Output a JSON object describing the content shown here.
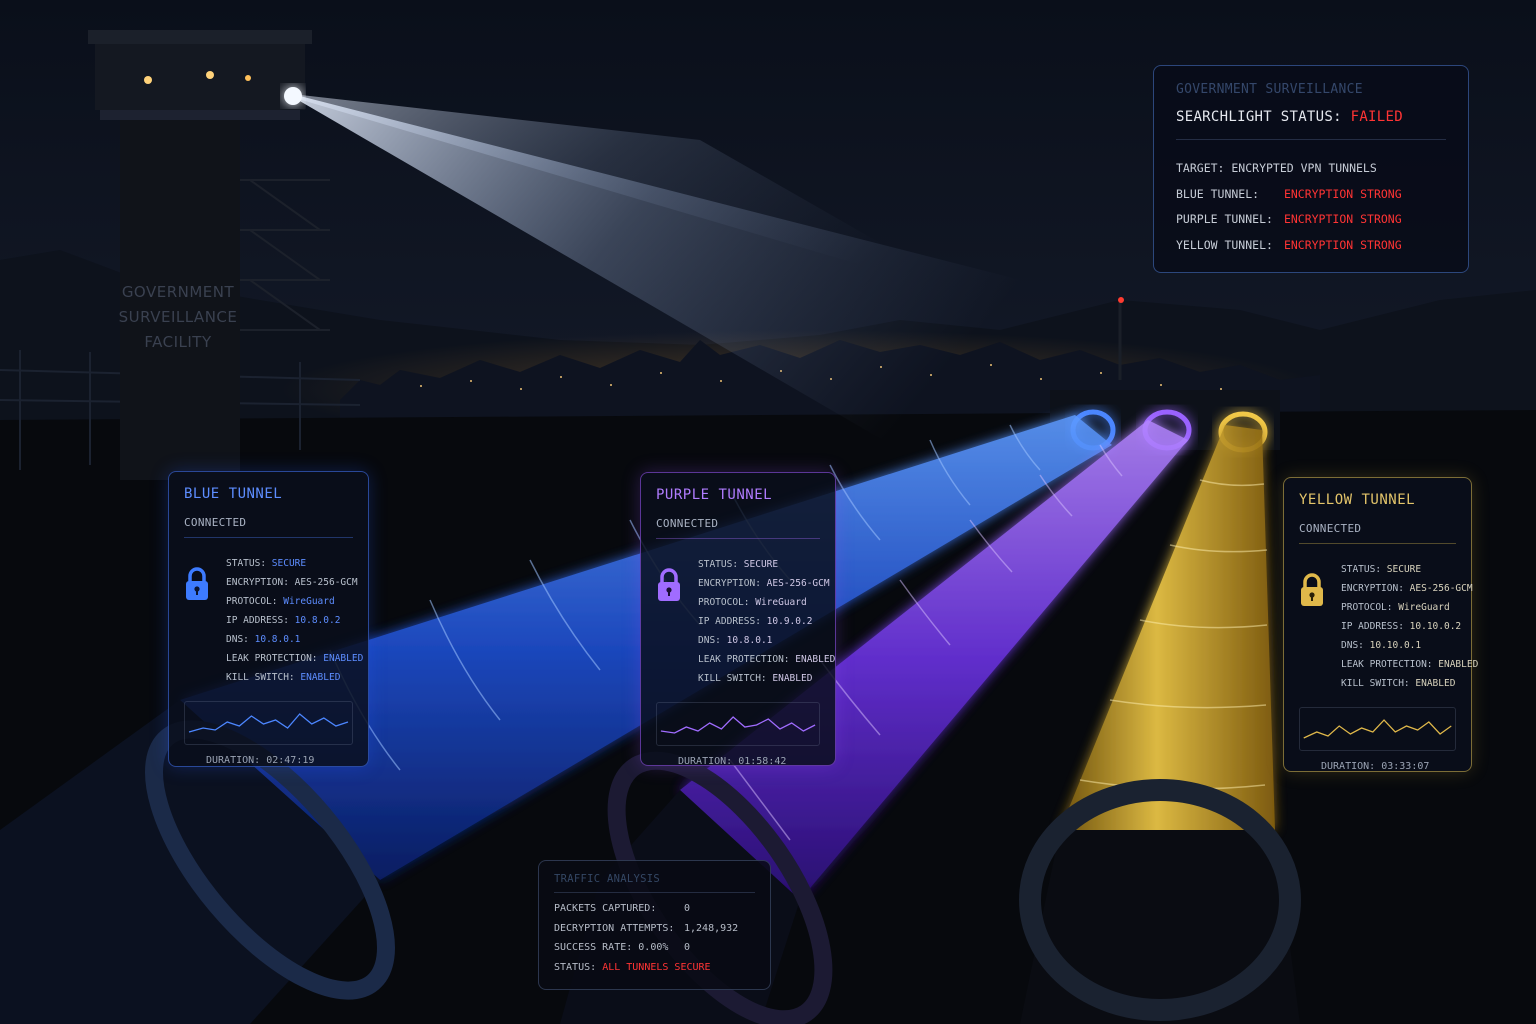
{
  "facility": {
    "sign_lines": [
      "GOVERNMENT",
      "SURVEILLANCE",
      "FACILITY"
    ]
  },
  "surveillance": {
    "header": "GOVERNMENT SURVEILLANCE",
    "status_label": "SEARCHLIGHT STATUS:",
    "status_value": "FAILED",
    "target": "TARGET: ENCRYPTED VPN TUNNELS",
    "rows": [
      {
        "label": "BLUE TUNNEL:",
        "value": "ENCRYPTION STRONG"
      },
      {
        "label": "PURPLE TUNNEL:",
        "value": "ENCRYPTION STRONG"
      },
      {
        "label": "YELLOW TUNNEL:",
        "value": "ENCRYPTION STRONG"
      }
    ]
  },
  "tunnels": {
    "blue": {
      "title": "BLUE TUNNEL",
      "connection": "CONNECTED",
      "rows": [
        {
          "label": "STATUS:",
          "value": "SECURE"
        },
        {
          "label": "ENCRYPTION:",
          "value": "AES-256-GCM"
        },
        {
          "label": "PROTOCOL:",
          "value": "WireGuard"
        },
        {
          "label": "IP ADDRESS:",
          "value": "10.8.0.2"
        },
        {
          "label": "DNS:",
          "value": "10.8.0.1"
        },
        {
          "label": "LEAK PROTECTION:",
          "value": "ENABLED"
        },
        {
          "label": "KILL SWITCH:",
          "value": "ENABLED"
        }
      ],
      "duration_label": "DURATION:",
      "duration": "02:47:19",
      "accent": "#5d8dff"
    },
    "purple": {
      "title": "PURPLE TUNNEL",
      "connection": "CONNECTED",
      "rows": [
        {
          "label": "STATUS:",
          "value": "SECURE"
        },
        {
          "label": "ENCRYPTION:",
          "value": "AES-256-GCM"
        },
        {
          "label": "PROTOCOL:",
          "value": "WireGuard"
        },
        {
          "label": "IP ADDRESS:",
          "value": "10.9.0.2"
        },
        {
          "label": "DNS:",
          "value": "10.8.0.1"
        },
        {
          "label": "LEAK PROTECTION:",
          "value": "ENABLED"
        },
        {
          "label": "KILL SWITCH:",
          "value": "ENABLED"
        }
      ],
      "duration_label": "DURATION:",
      "duration": "01:58:42",
      "accent": "#b07cff"
    },
    "yellow": {
      "title": "YELLOW TUNNEL",
      "connection": "CONNECTED",
      "rows": [
        {
          "label": "STATUS:",
          "value": "SECURE"
        },
        {
          "label": "ENCRYPTION:",
          "value": "AES-256-GCM"
        },
        {
          "label": "PROTOCOL:",
          "value": "WireGuard"
        },
        {
          "label": "IP ADDRESS:",
          "value": "10.10.0.2"
        },
        {
          "label": "DNS:",
          "value": "10.10.0.1"
        },
        {
          "label": "LEAK PROTECTION:",
          "value": "ENABLED"
        },
        {
          "label": "KILL SWITCH:",
          "value": "ENABLED"
        }
      ],
      "duration_label": "DURATION:",
      "duration": "03:33:07",
      "accent": "#e3c46a"
    }
  },
  "traffic": {
    "header": "TRAFFIC ANALYSIS",
    "rows": [
      {
        "label": "PACKETS CAPTURED:",
        "value": "0"
      },
      {
        "label": "DECRYPTION ATTEMPTS:",
        "value": "1,248,932"
      },
      {
        "label": "SUCCESS RATE: 0.00%",
        "value": "0"
      }
    ],
    "status_label": "STATUS:",
    "status_value": "ALL TUNNELS SECURE"
  },
  "colors": {
    "failed": "#ff3434",
    "blue_tunnel": "#2f6bff",
    "purple_tunnel": "#8a4dff",
    "yellow_tunnel": "#f0c43a"
  }
}
